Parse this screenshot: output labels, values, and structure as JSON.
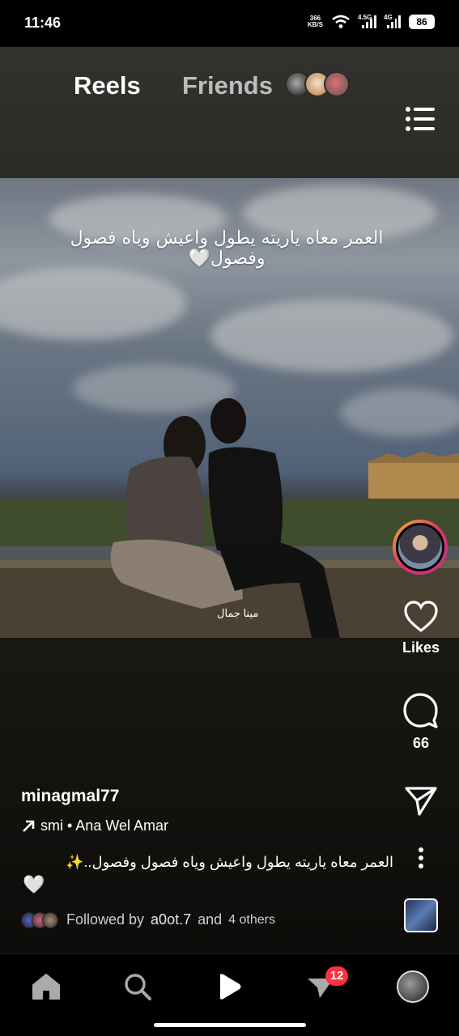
{
  "status_bar": {
    "time": "11:46",
    "net_speed_value": "366",
    "net_speed_unit": "KB/S",
    "signal_1_label": "4.5G",
    "signal_2_label": "4G",
    "battery": "86"
  },
  "header": {
    "tab_reels": "Reels",
    "tab_friends": "Friends"
  },
  "post": {
    "overlay_text": "العمر معاه ياريته يطول واعيش وياه فصول وفصول🤍",
    "watermark": "مينا جمال",
    "username": "minagmal77",
    "audio": "smi • Ana Wel Amar",
    "caption": "العمر معاه ياريته يطول واعيش وياه فصول وفصول..✨",
    "caption_line2": "🤍",
    "followed_by_prefix": "Followed by",
    "followed_by_user": "a0ot.7",
    "followed_by_and": "and",
    "followed_by_others": "4 others"
  },
  "actions": {
    "likes_label": "Likes",
    "comments_count": "66"
  },
  "bottom_nav": {
    "notifications_badge": "12"
  },
  "colors": {
    "badge": "#ff3040",
    "story_ring_start": "#f7b733",
    "story_ring_end": "#c13584"
  },
  "icons": [
    "home-icon",
    "search-icon",
    "reels-icon",
    "activity-icon",
    "menu-icon",
    "heart-icon",
    "comment-icon",
    "send-icon",
    "more-icon",
    "arrow-icon"
  ]
}
